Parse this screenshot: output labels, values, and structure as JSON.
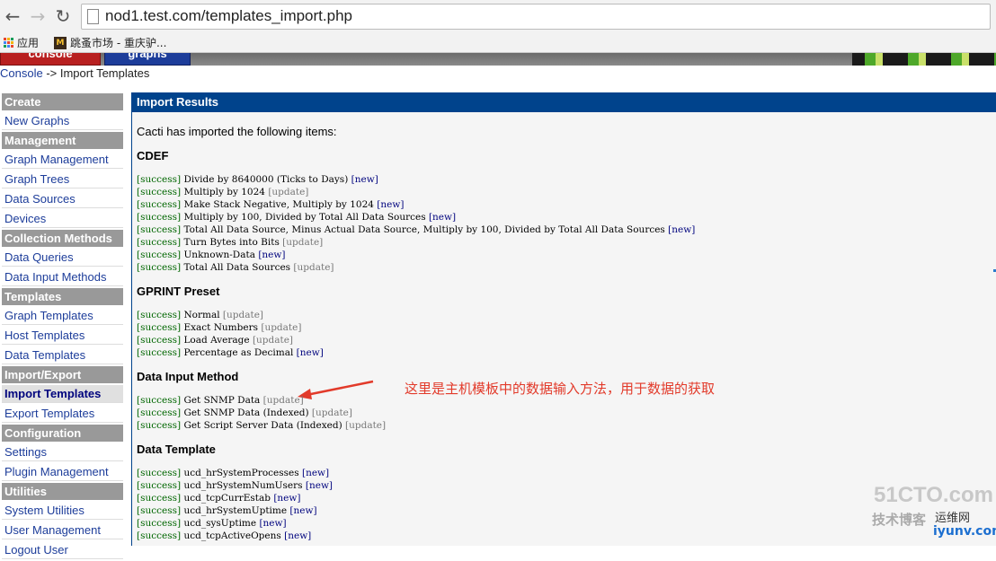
{
  "browser": {
    "url": "nod1.test.com/templates_import.php",
    "bookmarks": [
      "应用",
      "跳蚤市场 - 重庆驴..."
    ]
  },
  "header": {
    "tabs": [
      "console",
      "graphs"
    ]
  },
  "breadcrumb": {
    "link": "Console",
    "rest": " -> Import Templates"
  },
  "sidebar": [
    {
      "label": "Create",
      "type": "head"
    },
    {
      "label": "New Graphs",
      "type": "item"
    },
    {
      "label": "Management",
      "type": "head"
    },
    {
      "label": "Graph Management",
      "type": "item"
    },
    {
      "label": "Graph Trees",
      "type": "item"
    },
    {
      "label": "Data Sources",
      "type": "item"
    },
    {
      "label": "Devices",
      "type": "item"
    },
    {
      "label": "Collection Methods",
      "type": "head"
    },
    {
      "label": "Data Queries",
      "type": "item"
    },
    {
      "label": "Data Input Methods",
      "type": "item"
    },
    {
      "label": "Templates",
      "type": "head"
    },
    {
      "label": "Graph Templates",
      "type": "item"
    },
    {
      "label": "Host Templates",
      "type": "item"
    },
    {
      "label": "Data Templates",
      "type": "item"
    },
    {
      "label": "Import/Export",
      "type": "head"
    },
    {
      "label": "Import Templates",
      "type": "item",
      "active": true
    },
    {
      "label": "Export Templates",
      "type": "item"
    },
    {
      "label": "Configuration",
      "type": "head"
    },
    {
      "label": "Settings",
      "type": "item"
    },
    {
      "label": "Plugin Management",
      "type": "item"
    },
    {
      "label": "Utilities",
      "type": "head"
    },
    {
      "label": "System Utilities",
      "type": "item"
    },
    {
      "label": "User Management",
      "type": "item"
    },
    {
      "label": "Logout User",
      "type": "item"
    }
  ],
  "main": {
    "title": "Import Results",
    "intro": "Cacti has imported the following items:",
    "sections": [
      {
        "heading": "CDEF",
        "items": [
          {
            "status": "[success]",
            "name": "Divide by 8640000 (Ticks to Days)",
            "result": "[new]"
          },
          {
            "status": "[success]",
            "name": "Multiply by 1024",
            "result": "[update]"
          },
          {
            "status": "[success]",
            "name": "Make Stack Negative, Multiply by 1024",
            "result": "[new]"
          },
          {
            "status": "[success]",
            "name": "Multiply by 100, Divided by Total All Data Sources",
            "result": "[new]"
          },
          {
            "status": "[success]",
            "name": "Total All Data Source, Minus Actual Data Source, Multiply by 100, Divided by Total All Data Sources",
            "result": "[new]"
          },
          {
            "status": "[success]",
            "name": "Turn Bytes into Bits",
            "result": "[update]"
          },
          {
            "status": "[success]",
            "name": "Unknown-Data",
            "result": "[new]"
          },
          {
            "status": "[success]",
            "name": "Total All Data Sources",
            "result": "[update]"
          }
        ]
      },
      {
        "heading": "GPRINT Preset",
        "items": [
          {
            "status": "[success]",
            "name": "Normal",
            "result": "[update]"
          },
          {
            "status": "[success]",
            "name": "Exact Numbers",
            "result": "[update]"
          },
          {
            "status": "[success]",
            "name": "Load Average",
            "result": "[update]"
          },
          {
            "status": "[success]",
            "name": "Percentage as Decimal",
            "result": "[new]"
          }
        ]
      },
      {
        "heading": "Data Input Method",
        "items": [
          {
            "status": "[success]",
            "name": "Get SNMP Data",
            "result": "[update]"
          },
          {
            "status": "[success]",
            "name": "Get SNMP Data (Indexed)",
            "result": "[update]"
          },
          {
            "status": "[success]",
            "name": "Get Script Server Data (Indexed)",
            "result": "[update]"
          }
        ]
      },
      {
        "heading": "Data Template",
        "items": [
          {
            "status": "[success]",
            "name": "ucd_hrSystemProcesses",
            "result": "[new]"
          },
          {
            "status": "[success]",
            "name": "ucd_hrSystemNumUsers",
            "result": "[new]"
          },
          {
            "status": "[success]",
            "name": "ucd_tcpCurrEstab",
            "result": "[new]"
          },
          {
            "status": "[success]",
            "name": "ucd_hrSystemUptime",
            "result": "[new]"
          },
          {
            "status": "[success]",
            "name": "ucd_sysUptime",
            "result": "[new]"
          },
          {
            "status": "[success]",
            "name": "ucd_tcpActiveOpens",
            "result": "[new]"
          }
        ]
      }
    ],
    "annotation": "这里是主机模板中的数据输入方法，用于数据的获取"
  },
  "watermark": {
    "line1": "51CTO.com",
    "line2": "技术博客",
    "line3": "运维网",
    "line4": "iyunv.com"
  },
  "colors": {
    "accent": "#00438c",
    "sidebar_head": "#999999",
    "success": "#006600",
    "new": "#00047e",
    "update": "#777777",
    "annotation": "#e23a2a"
  }
}
